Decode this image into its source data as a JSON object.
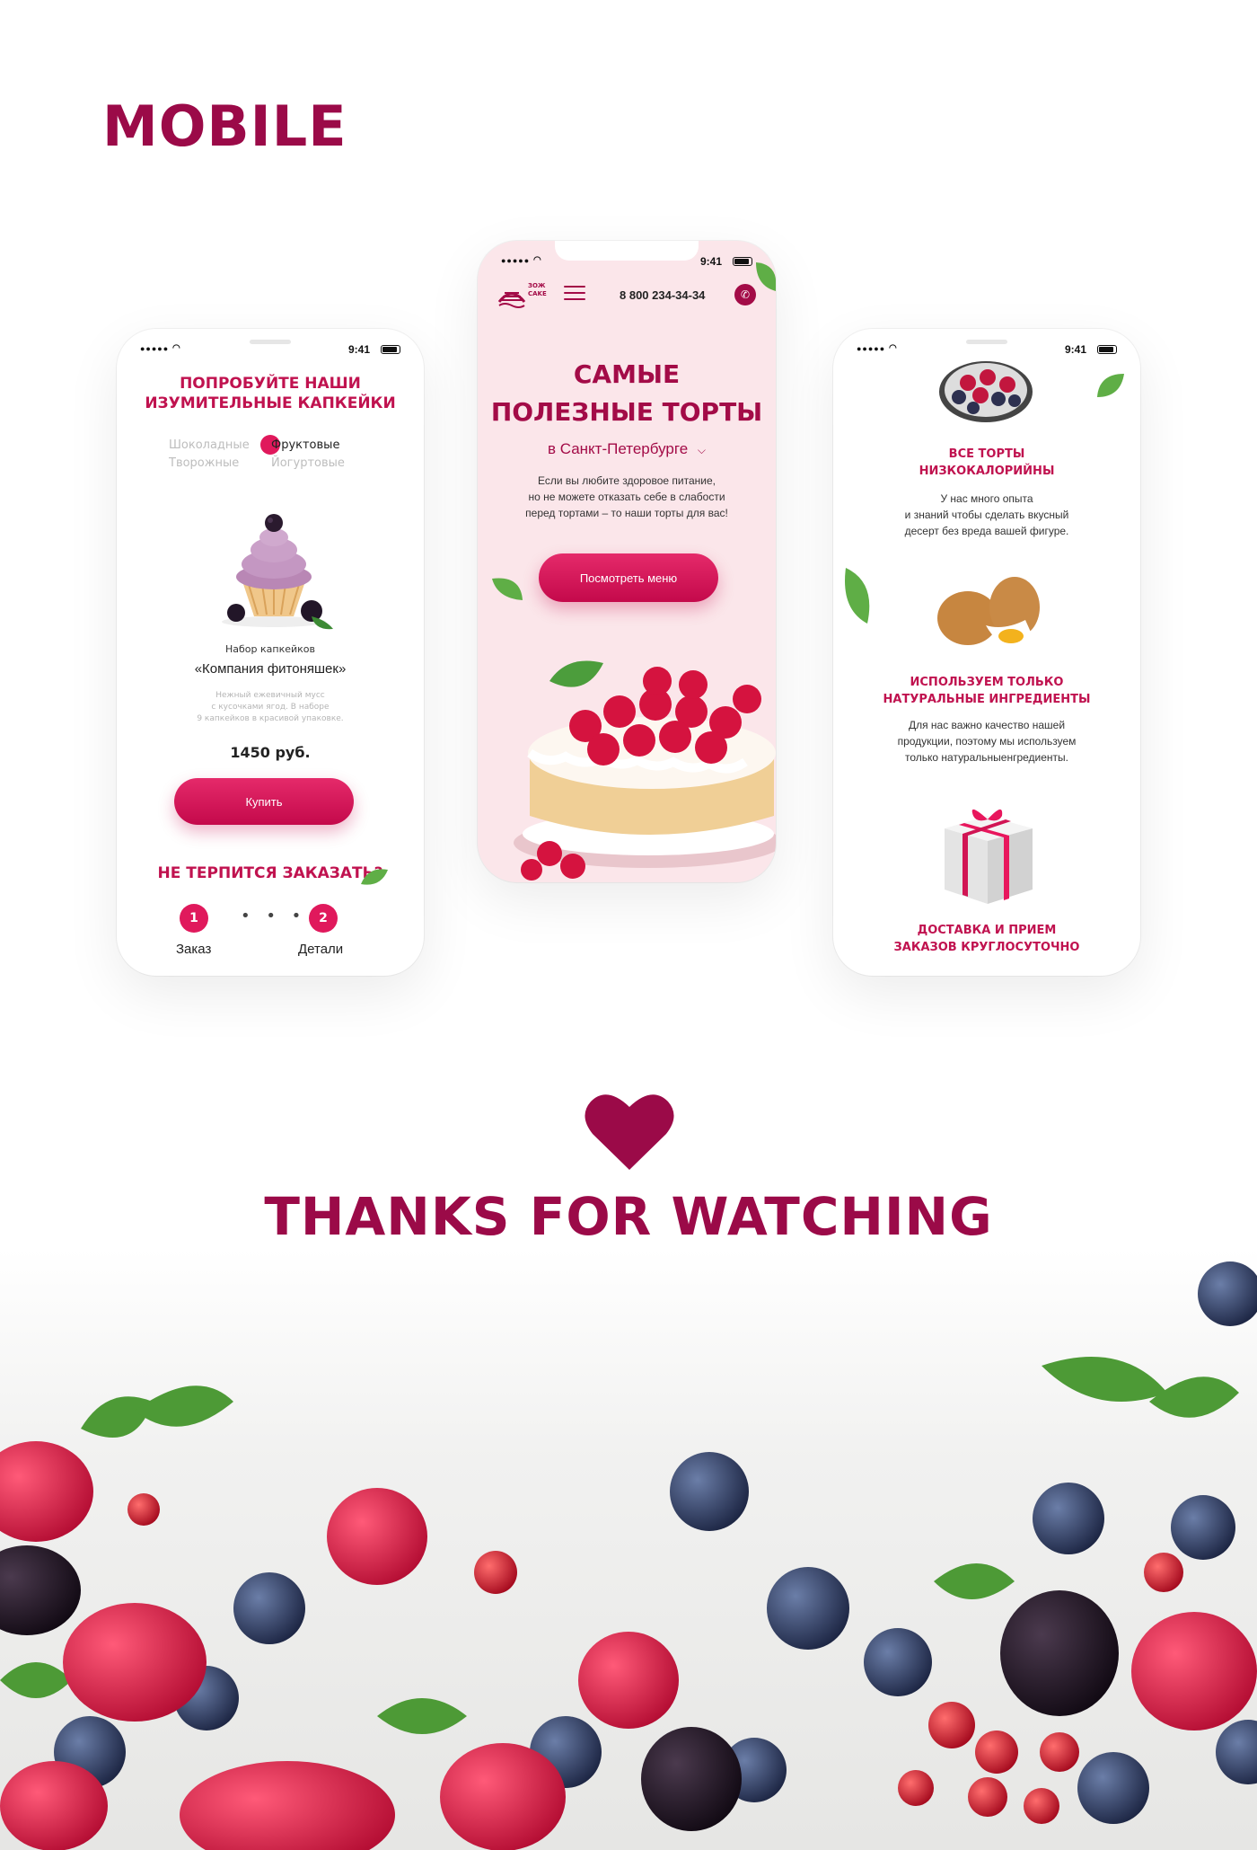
{
  "section_title": "MOBILE",
  "status_time": "9:41",
  "left_phone": {
    "title_line1": "ПОПРОБУЙТЕ НАШИ",
    "title_line2": "ИЗУМИТЕЛЬНЫЕ КАПКЕЙКИ",
    "tabs": [
      {
        "label": "Шоколадные",
        "active": false
      },
      {
        "label": "Фруктовые",
        "active": true
      },
      {
        "label": "Творожные",
        "active": false
      },
      {
        "label": "Йогуртовые",
        "active": false
      }
    ],
    "set_label": "Набор капкейков",
    "product_name": "«Компания фитоняшек»",
    "desc_line1": "Нежный ежевичный мусс",
    "desc_line2": "с кусочками ягод. В наборе",
    "desc_line3": "9 капкейков в красивой упаковке.",
    "price": "1450 руб.",
    "buy_label": "Купить",
    "order_title": "НЕ ТЕРПИТСЯ ЗАКАЗАТЬ?",
    "steps": [
      {
        "num": "1",
        "label": "Заказ"
      },
      {
        "num": "2",
        "label": "Детали"
      }
    ]
  },
  "mid_phone": {
    "logo_line1": "ЗОЖ",
    "logo_line2": "CAKE",
    "phone_number": "8 800 234-34-34",
    "hero_line1": "САМЫЕ",
    "hero_line2": "ПОЛЕЗНЫЕ ТОРТЫ",
    "city": "в Санкт-Петербурге",
    "text_line1": "Если вы любите здоровое питание,",
    "text_line2": "но не можете отказать себе в слабости",
    "text_line3": "перед тортами – то наши торты для вас!",
    "menu_button": "Посмотреть меню"
  },
  "right_phone": {
    "feature1_title1": "ВСЕ ТОРТЫ",
    "feature1_title2": "НИЗКОКАЛОРИЙНЫ",
    "feature1_text1": "У нас много опыта",
    "feature1_text2": "и знаний чтобы сделать вкусный",
    "feature1_text3": "десерт без вреда вашей фигуре.",
    "feature2_title1": "ИСПОЛЬЗУЕМ ТОЛЬКО",
    "feature2_title2": "НАТУРАЛЬНЫЕ ИНГРЕДИЕНТЫ",
    "feature2_text1": "Для нас важно качество нашей",
    "feature2_text2": "продукции, поэтому мы используем",
    "feature2_text3": "только натуральныенгредиенты.",
    "feature3_title1": "ДОСТАВКА И ПРИЕМ",
    "feature3_title2": "ЗАКАЗОВ КРУГЛОСУТОЧНО"
  },
  "thanks": "THANKS FOR WATCHING",
  "colors": {
    "brand": "#9b0a48",
    "accent": "#e0195c",
    "hero_bg": "#fbe6ea"
  },
  "icons": [
    "heart-icon",
    "phone-icon",
    "menu-icon",
    "chevron-down-icon",
    "wifi-icon",
    "battery-icon"
  ]
}
